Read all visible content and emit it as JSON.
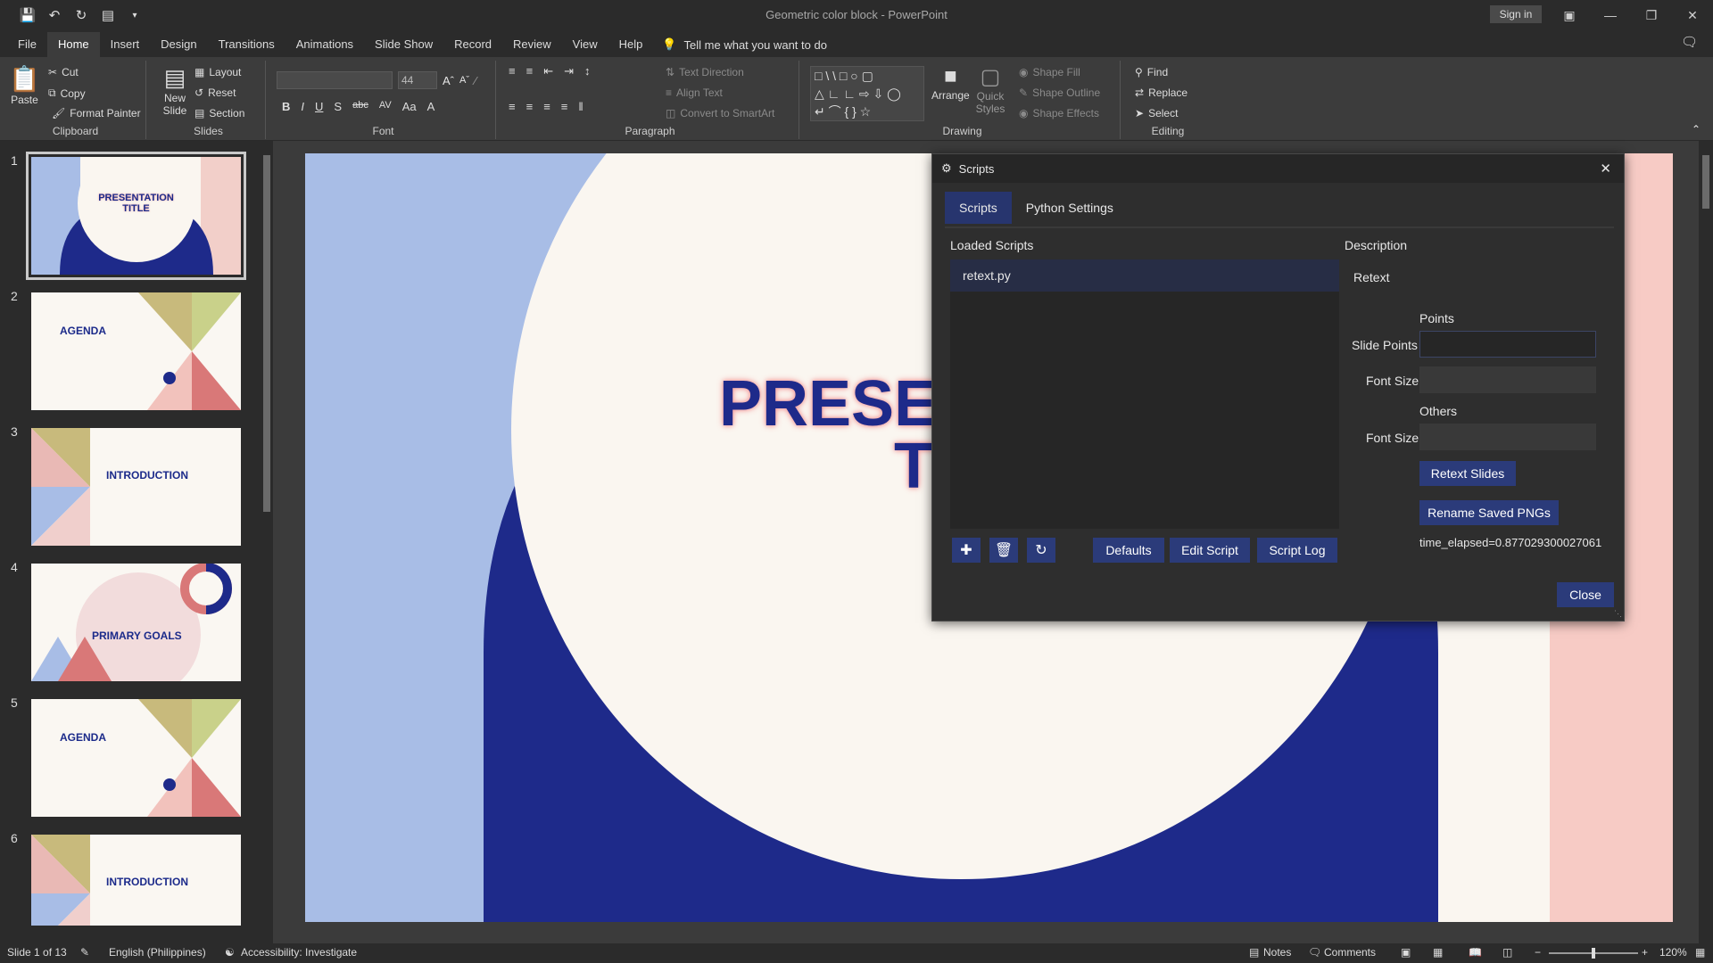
{
  "window": {
    "title": "Geometric color block  -  PowerPoint",
    "signin": "Sign in"
  },
  "tabs": [
    "File",
    "Home",
    "Insert",
    "Design",
    "Transitions",
    "Animations",
    "Slide Show",
    "Record",
    "Review",
    "View",
    "Help"
  ],
  "tell_me": "Tell me what you want to do",
  "ribbon": {
    "clipboard": {
      "label": "Clipboard",
      "paste": "Paste",
      "cut": "Cut",
      "copy": "Copy",
      "format_painter": "Format Painter"
    },
    "slides": {
      "label": "Slides",
      "new_slide": "New Slide",
      "layout": "Layout",
      "reset": "Reset",
      "section": "Section"
    },
    "font": {
      "label": "Font",
      "size": "44"
    },
    "paragraph": {
      "label": "Paragraph",
      "text_direction": "Text Direction",
      "align_text": "Align Text",
      "convert": "Convert to SmartArt"
    },
    "drawing": {
      "label": "Drawing",
      "arrange": "Arrange",
      "quick_styles": "Quick Styles",
      "shape_fill": "Shape Fill",
      "shape_outline": "Shape Outline",
      "shape_effects": "Shape Effects"
    },
    "editing": {
      "label": "Editing",
      "find": "Find",
      "replace": "Replace",
      "select": "Select"
    }
  },
  "thumbnails": [
    {
      "num": "1",
      "title": "PRESENTATION TITLE"
    },
    {
      "num": "2",
      "title": "AGENDA"
    },
    {
      "num": "3",
      "title": "INTRODUCTION"
    },
    {
      "num": "4",
      "title": "PRIMARY GOALS"
    },
    {
      "num": "5",
      "title": "AGENDA"
    },
    {
      "num": "6",
      "title": "INTRODUCTION"
    }
  ],
  "slide": {
    "title_line1": "PRESE",
    "title_line2": "T"
  },
  "dialog": {
    "title": "Scripts",
    "tabs": [
      "Scripts",
      "Python Settings"
    ],
    "loaded_scripts_label": "Loaded Scripts",
    "scripts": [
      "retext.py"
    ],
    "description_label": "Description",
    "description": "Retext",
    "points_header": "Points",
    "slide_points_label": "Slide Points",
    "slide_points_value": "",
    "font_size_label": "Font Size",
    "font_size_value": "",
    "others_header": "Others",
    "others_font_size_label": "Font Size",
    "others_font_size_value": "",
    "retext_button": "Retext Slides",
    "rename_button": "Rename Saved PNGs",
    "elapsed": "time_elapsed=0.877029300027061",
    "defaults_button": "Defaults",
    "edit_button": "Edit Script",
    "log_button": "Script Log",
    "close_button": "Close"
  },
  "status": {
    "slide_of": "Slide 1 of 13",
    "language": "English (Philippines)",
    "accessibility": "Accessibility: Investigate",
    "notes": "Notes",
    "comments": "Comments",
    "zoom": "120%"
  },
  "colors": {
    "navy": "#1e2a8a",
    "sky": "#a8bde6",
    "pink": "#f2cfc9",
    "cream": "#faf6f0",
    "accent": "#2b3b7a"
  }
}
